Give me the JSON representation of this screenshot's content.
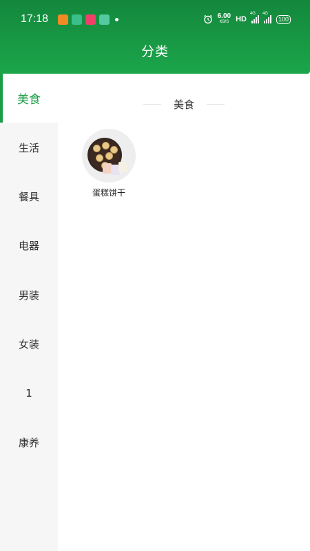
{
  "statusbar": {
    "time": "17:18",
    "speed_value": "6.00",
    "speed_unit": "KB/S",
    "hd": "HD",
    "signal1_label": "4G",
    "signal2_label": "4G",
    "battery": "100"
  },
  "header": {
    "title": "分类"
  },
  "sidebar": {
    "items": [
      {
        "label": "美食"
      },
      {
        "label": "生活"
      },
      {
        "label": "餐具"
      },
      {
        "label": "电器"
      },
      {
        "label": "男装"
      },
      {
        "label": "女装"
      },
      {
        "label": "1"
      },
      {
        "label": "康养"
      }
    ]
  },
  "content": {
    "section_title": "美食",
    "items": [
      {
        "label": "蛋糕饼干"
      }
    ]
  },
  "colors": {
    "primary_green": "#1b9e45",
    "header_top": "#13873c",
    "sidebar_bg": "#f6f6f6"
  }
}
